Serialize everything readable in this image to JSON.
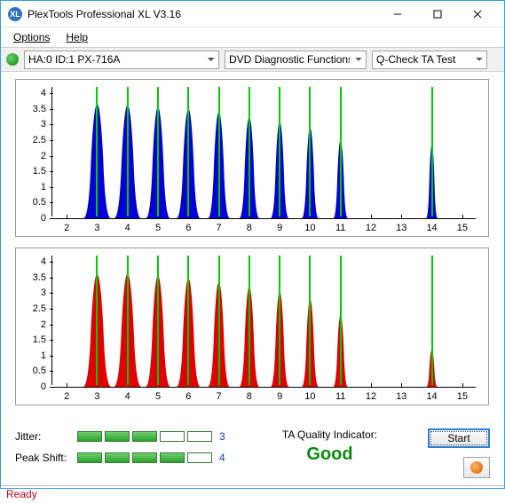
{
  "window": {
    "title": "PlexTools Professional XL V3.16"
  },
  "menu": {
    "options": "Options",
    "help": "Help"
  },
  "toolbar": {
    "drive": "HA:0 ID:1   PX-716A",
    "func": "DVD Diagnostic Functions",
    "test": "Q-Check TA Test"
  },
  "chart_data": [
    {
      "type": "area",
      "color": "#0000d6",
      "ylim": [
        0,
        4.2
      ],
      "yticks": [
        0,
        0.5,
        1,
        1.5,
        2,
        2.5,
        3,
        3.5,
        4
      ],
      "xlim": [
        1.5,
        15.5
      ],
      "xticks": [
        2,
        3,
        4,
        5,
        6,
        7,
        8,
        9,
        10,
        11,
        12,
        13,
        14,
        15
      ],
      "peaks": [
        {
          "x": 3.0,
          "h": 3.65,
          "w": 0.9
        },
        {
          "x": 4.0,
          "h": 3.62,
          "w": 0.88
        },
        {
          "x": 5.0,
          "h": 3.55,
          "w": 0.8
        },
        {
          "x": 6.0,
          "h": 3.5,
          "w": 0.78
        },
        {
          "x": 7.0,
          "h": 3.4,
          "w": 0.72
        },
        {
          "x": 8.0,
          "h": 3.25,
          "w": 0.66
        },
        {
          "x": 9.0,
          "h": 3.1,
          "w": 0.6
        },
        {
          "x": 10.0,
          "h": 2.9,
          "w": 0.55
        },
        {
          "x": 11.0,
          "h": 2.5,
          "w": 0.48
        },
        {
          "x": 14.0,
          "h": 2.35,
          "w": 0.38
        }
      ]
    },
    {
      "type": "area",
      "color": "#e00000",
      "ylim": [
        0,
        4.2
      ],
      "yticks": [
        0,
        0.5,
        1,
        1.5,
        2,
        2.5,
        3,
        3.5,
        4
      ],
      "xlim": [
        1.5,
        15.5
      ],
      "xticks": [
        2,
        3,
        4,
        5,
        6,
        7,
        8,
        9,
        10,
        11,
        12,
        13,
        14,
        15
      ],
      "peaks": [
        {
          "x": 3.0,
          "h": 3.6,
          "w": 0.92
        },
        {
          "x": 4.0,
          "h": 3.62,
          "w": 0.9
        },
        {
          "x": 5.0,
          "h": 3.55,
          "w": 0.82
        },
        {
          "x": 6.0,
          "h": 3.48,
          "w": 0.78
        },
        {
          "x": 7.0,
          "h": 3.35,
          "w": 0.72
        },
        {
          "x": 8.0,
          "h": 3.2,
          "w": 0.66
        },
        {
          "x": 9.0,
          "h": 3.05,
          "w": 0.6
        },
        {
          "x": 10.0,
          "h": 2.8,
          "w": 0.55
        },
        {
          "x": 11.0,
          "h": 2.3,
          "w": 0.48
        },
        {
          "x": 14.0,
          "h": 1.2,
          "w": 0.36
        }
      ]
    }
  ],
  "metrics": {
    "jitter": {
      "label": "Jitter:",
      "value": "3",
      "bars": 5,
      "on": 3
    },
    "peakshift": {
      "label": "Peak Shift:",
      "value": "4",
      "bars": 5,
      "on": 4
    }
  },
  "quality": {
    "label": "TA Quality Indicator:",
    "value": "Good"
  },
  "actions": {
    "start": "Start"
  },
  "status": {
    "text": "Ready"
  }
}
